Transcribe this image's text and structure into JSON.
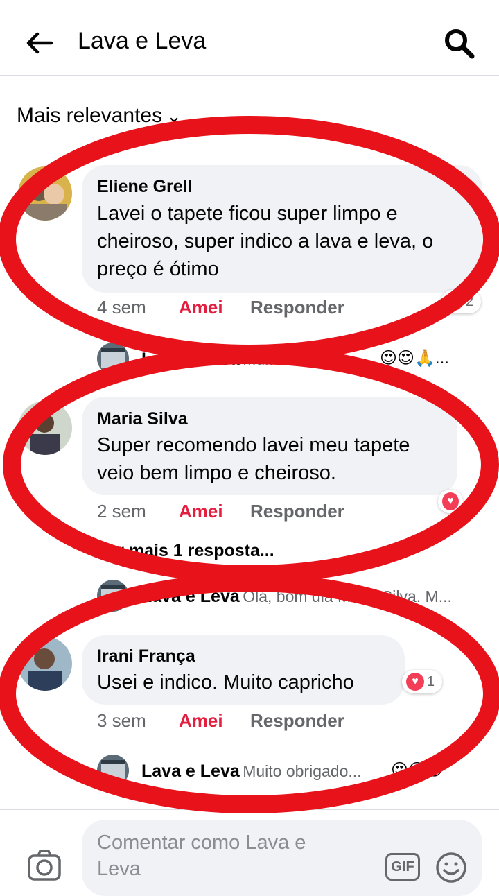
{
  "header": {
    "title": "Lava e Leva"
  },
  "sort": {
    "label": "Mais relevantes"
  },
  "comments": [
    {
      "name": "Eliene Grell",
      "text": "Lavei o tapete ficou super limpo e cheiroso, super indico a lava e leva, o preço é ótimo",
      "time": "4 sem",
      "reaction_label": "Amei",
      "reply_label": "Responder",
      "reaction_count": "2",
      "reply": {
        "name": "Lava e Leva",
        "text": "Muito obrigado...",
        "emojis": "😍😍🙏..."
      }
    },
    {
      "name": "Maria Silva",
      "text": "Super recomendo lavei meu tapete veio bem limpo e cheiroso.",
      "time": "2 sem",
      "reaction_label": "Amei",
      "reply_label": "Responder",
      "more_replies": "Ver mais 1 resposta...",
      "reply": {
        "name": "Lava e Leva",
        "text": "Olá, bom dia Maria Silva. M..."
      }
    },
    {
      "name": "Irani França",
      "text": "Usei e indico. Muito capricho",
      "time": "3 sem",
      "reaction_label": "Amei",
      "reply_label": "Responder",
      "reaction_count": "1",
      "reply": {
        "name": "Lava e Leva",
        "text": "Muito obrigado...",
        "emojis": "😍😍😄"
      }
    }
  ],
  "composer": {
    "placeholder": "Comentar como Lava e Leva",
    "gif_label": "GIF"
  },
  "colors": {
    "highlight_ring": "#e8121a",
    "amei": "#e41e3f",
    "bubble": "#f0f2f5"
  }
}
